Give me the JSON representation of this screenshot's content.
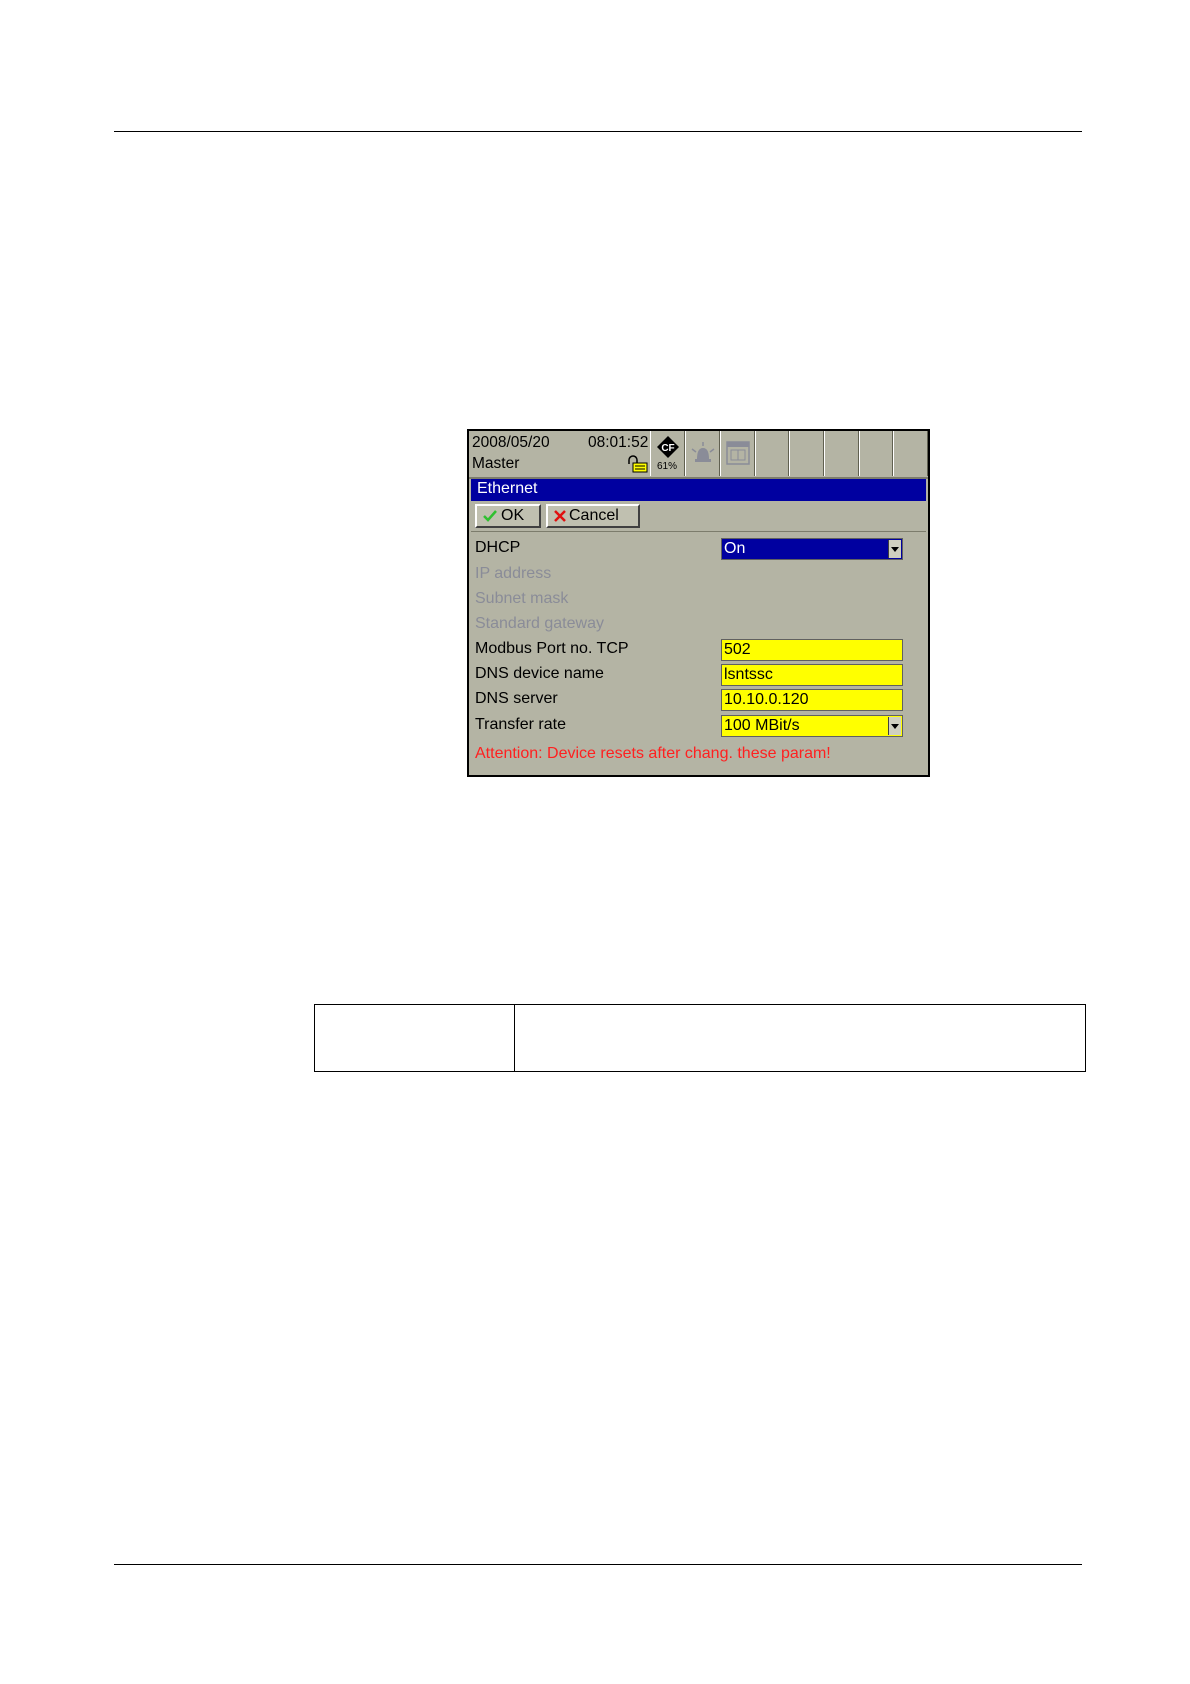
{
  "status_bar": {
    "date": "2008/05/20",
    "time": "08:01:52",
    "user": "Master",
    "cf_usage": "61%",
    "icons": [
      "unlock-icon",
      "cf-card-icon",
      "alarm-icon",
      "calendar-icon"
    ]
  },
  "dialog": {
    "title": "Ethernet",
    "ok_label": "OK",
    "cancel_label": "Cancel"
  },
  "fields": {
    "dhcp": {
      "label": "DHCP",
      "value": "On"
    },
    "ip_address": {
      "label": "IP address"
    },
    "subnet_mask": {
      "label": "Subnet mask"
    },
    "standard_gateway": {
      "label": "Standard gateway"
    },
    "modbus_port": {
      "label": "Modbus Port no. TCP",
      "value": "502"
    },
    "dns_device_name": {
      "label": "DNS device name",
      "value": "lsntssc"
    },
    "dns_server": {
      "label": "DNS server",
      "value": "10.10.0.120"
    },
    "transfer_rate": {
      "label": "Transfer rate",
      "value": "100 MBit/s"
    }
  },
  "warning": "Attention: Device resets after chang. these param!",
  "colors": {
    "screen_bg": "#b4b4a4",
    "title_bar": "#0000a0",
    "input_bg": "#ffff00",
    "warning_text": "#ff2020",
    "disabled_text": "#8a8c98"
  }
}
